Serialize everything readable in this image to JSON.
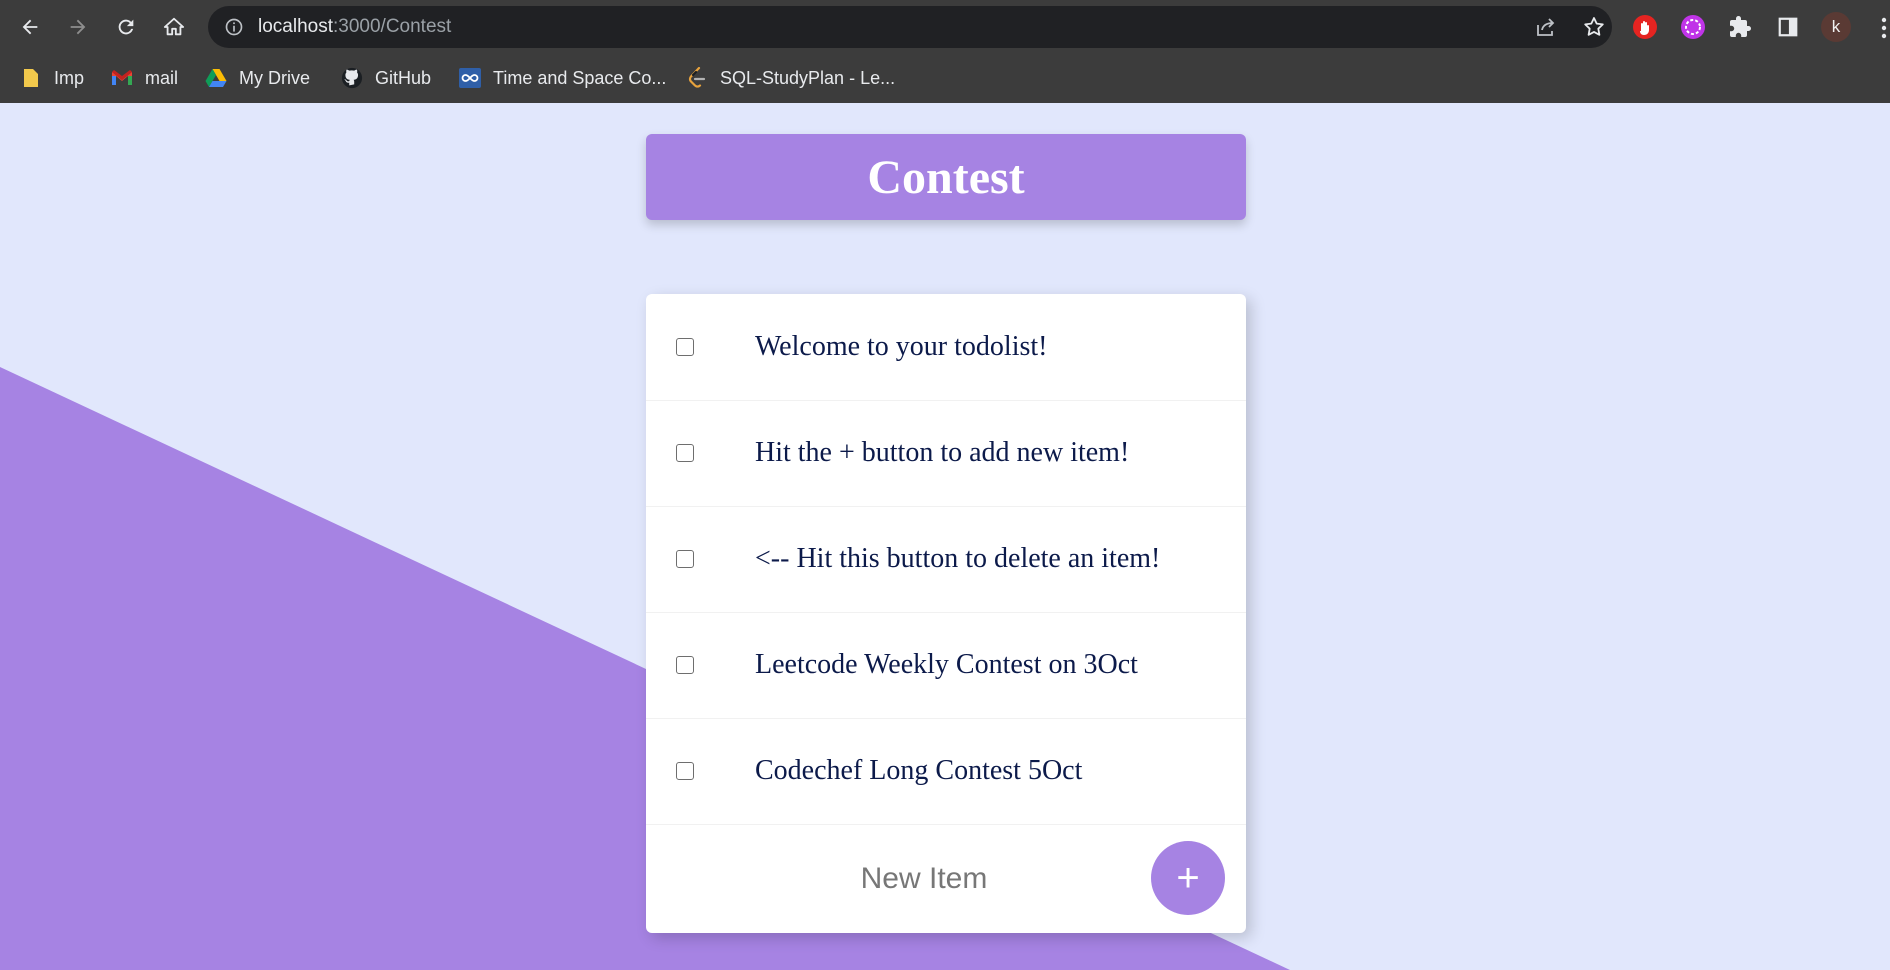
{
  "browser": {
    "url_host": "localhost",
    "url_path": ":3000/Contest",
    "profile_initial": "k",
    "bookmarks": [
      {
        "label": "Imp",
        "icon": "folder-icon"
      },
      {
        "label": "mail",
        "icon": "gmail-icon"
      },
      {
        "label": "My Drive",
        "icon": "google-drive-icon"
      },
      {
        "label": "GitHub",
        "icon": "github-icon"
      },
      {
        "label": "Time and Space Co...",
        "icon": "infinity-icon"
      },
      {
        "label": "SQL-StudyPlan - Le...",
        "icon": "leetcode-icon"
      }
    ]
  },
  "page": {
    "title": "Contest",
    "items": [
      {
        "text": "Welcome to your todolist!",
        "checked": false
      },
      {
        "text": "Hit the + button to add new item!",
        "checked": false
      },
      {
        "text": "<-- Hit this button to delete an item!",
        "checked": false
      },
      {
        "text": "Leetcode Weekly Contest on 3Oct",
        "checked": false
      },
      {
        "text": "Codechef Long Contest 5Oct",
        "checked": false
      }
    ],
    "new_item_placeholder": "New Item",
    "add_button_label": "+"
  },
  "colors": {
    "accent": "#a683e3",
    "background": "#e1e7fc",
    "item_text": "#0c1a4a",
    "chrome_bg": "#3c3c3c"
  }
}
